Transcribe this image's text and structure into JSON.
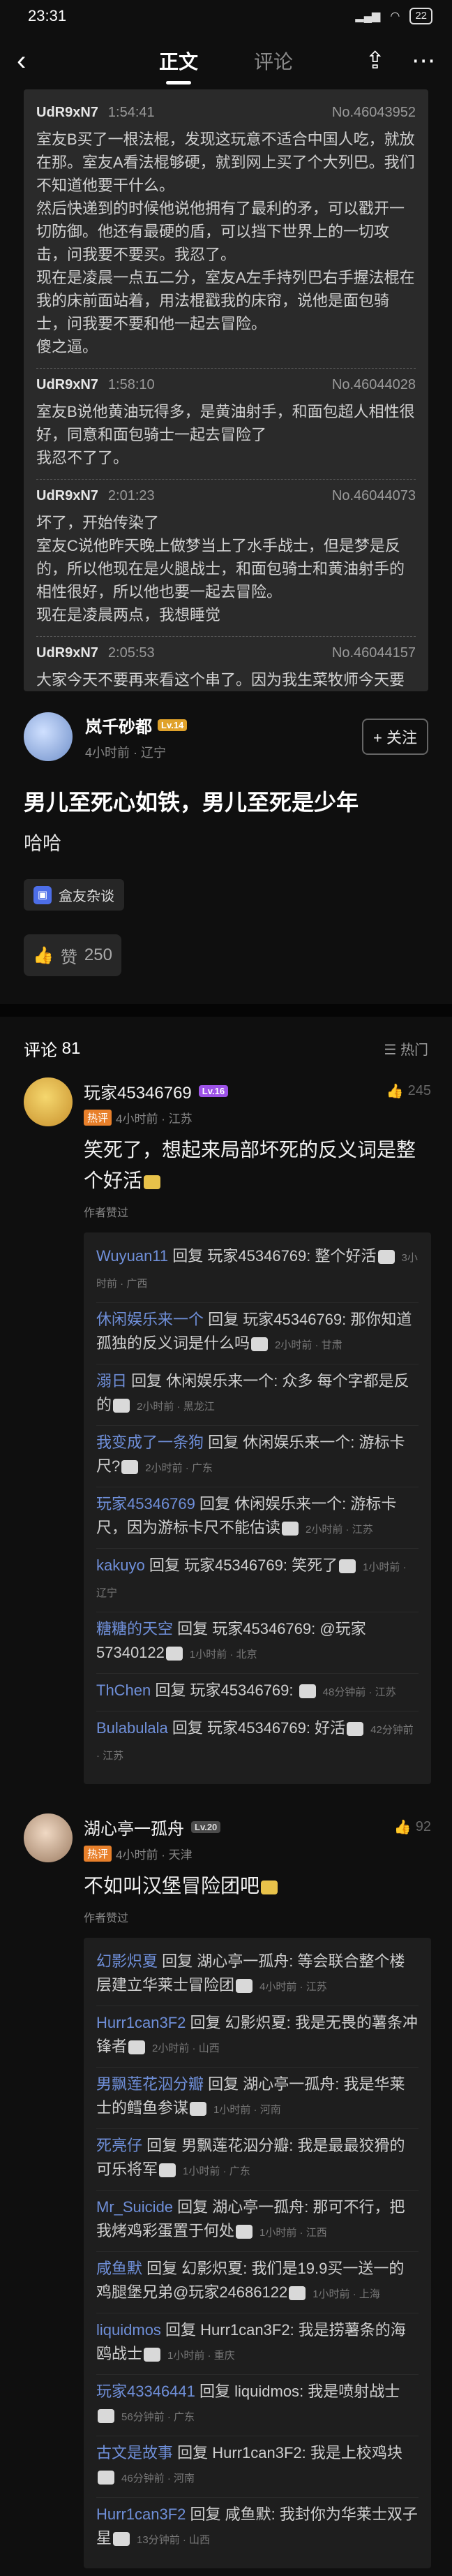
{
  "status": {
    "time": "23:31",
    "battery": "22"
  },
  "nav": {
    "tab_main": "正文",
    "tab_comments": "评论"
  },
  "quotes": [
    {
      "name": "UdR9xN7",
      "time": "1:54:41",
      "no": "No.46043952",
      "text": "室友B买了一根法棍，发现这玩意不适合中国人吃，就放在那。室友A看法棍够硬，就到网上买了个大列巴。我们不知道他要干什么。\n然后快递到的时候他说他拥有了最利的矛，可以戳开一切防御。他还有最硬的盾，可以挡下世界上的一切攻击，问我要不要买。我忍了。\n现在是凌晨一点五二分，室友A左手持列巴右手握法棍在我的床前面站着，用法棍戳我的床帘，说他是面包骑士，问我要不要和他一起去冒险。\n傻之逼。"
    },
    {
      "name": "UdR9xN7",
      "time": "1:58:10",
      "no": "No.46044028",
      "text": "室友B说他黄油玩得多，是黄油射手，和面包超人相性很好，同意和面包骑士一起去冒险了\n我忍不了了。"
    },
    {
      "name": "UdR9xN7",
      "time": "2:01:23",
      "no": "No.46044073",
      "text": "坏了，开始传染了\n室友C说他昨天晚上做梦当上了水手战士，但是梦是反的，所以他现在是火腿战士，和面包骑士和黄油射手的相性很好，所以他也要一起去冒险。\n现在是凌晨两点，我想睡觉"
    },
    {
      "name": "UdR9xN7",
      "time": "2:05:53",
      "no": "No.46044157",
      "text": "大家今天不要再来看这个串了。因为我生菜牧师今天要和伙伴们一起出发去冒险了，没空更新。"
    }
  ],
  "author": {
    "name": "岚千砂都",
    "level": "Lv.14",
    "time": "4小时前",
    "location": "辽宁",
    "follow": "+ 关注"
  },
  "post": {
    "title": "男儿至死心如铁，男儿至死是少年",
    "body": "哈哈",
    "tag": "盒友杂谈",
    "likes": "250"
  },
  "comments_header": {
    "label": "评论",
    "count": "81",
    "sort": "热门"
  },
  "comments": [
    {
      "name": "玩家45346769",
      "level": "Lv.16",
      "likes": "245",
      "badge": "热评",
      "time": "4小时前",
      "location": "江苏",
      "text": "笑死了，想起来局部坏死的反义词是整个好活",
      "author_liked": "作者赞过",
      "replies": [
        {
          "user": "Wuyuan11",
          "to": "玩家45346769",
          "text": "整个好活",
          "meta": "3小时前 · 广西"
        },
        {
          "user": "休闲娱乐来一个",
          "to": "玩家45346769",
          "text": "那你知道孤独的反义词是什么吗",
          "meta": "2小时前 · 甘肃"
        },
        {
          "user": "溺日",
          "to": "休闲娱乐来一个",
          "text": "众多 每个字都是反的",
          "meta": "2小时前 · 黑龙江"
        },
        {
          "user": "我变成了一条狗",
          "to": "休闲娱乐来一个",
          "text": "游标卡尺?",
          "meta": "2小时前 · 广东"
        },
        {
          "user": "玩家45346769",
          "to": "休闲娱乐来一个",
          "text": "游标卡尺，因为游标卡尺不能估读",
          "meta": "2小时前 · 江苏"
        },
        {
          "user": "kakuyo",
          "to": "玩家45346769",
          "text": "笑死了",
          "meta": "1小时前 · 辽宁"
        },
        {
          "user": "糖糖的天空",
          "to": "玩家45346769",
          "text": "@玩家57340122",
          "meta": "1小时前 · 北京"
        },
        {
          "user": "ThChen",
          "to": "玩家45346769",
          "text": "",
          "meta": "48分钟前 · 江苏"
        },
        {
          "user": "Bulabulala",
          "to": "玩家45346769",
          "text": "好活",
          "meta": "42分钟前 · 江苏"
        }
      ]
    },
    {
      "name": "湖心亭一孤舟",
      "level": "Lv.20",
      "likes": "92",
      "badge": "热评",
      "time": "4小时前",
      "location": "天津",
      "text": "不如叫汉堡冒险团吧",
      "author_liked": "作者赞过",
      "replies": [
        {
          "user": "幻影炽夏",
          "to": "湖心亭一孤舟",
          "text": "等会联合整个楼层建立华莱士冒险团",
          "meta": "4小时前 · 江苏"
        },
        {
          "user": "Hurr1can3F2",
          "to": "幻影炽夏",
          "text": "我是无畏的薯条冲锋者",
          "meta": "2小时前 · 山西"
        },
        {
          "user": "男飘莲花泅分瓣",
          "to": "湖心亭一孤舟",
          "text": "我是华莱士的鳕鱼参谋",
          "meta": "1小时前 · 河南"
        },
        {
          "user": "死亮仔",
          "to": "男飘莲花泅分瓣",
          "text": "我是最最狡猾的可乐将军",
          "meta": "1小时前 · 广东"
        },
        {
          "user": "Mr_Suicide",
          "to": "湖心亭一孤舟",
          "text": "那可不行，把我烤鸡彩蛋置于何处",
          "meta": "1小时前 · 江西"
        },
        {
          "user": "咸鱼默",
          "to": "幻影炽夏",
          "text": "我们是19.9买一送一的鸡腿堡兄弟@玩家24686122",
          "meta": "1小时前 · 上海"
        },
        {
          "user": "liquidmos",
          "to": "Hurr1can3F2",
          "text": "我是捞薯条的海鸥战士",
          "meta": "1小时前 · 重庆"
        },
        {
          "user": "玩家43346441",
          "to": "liquidmos",
          "text": "我是喷射战士",
          "meta": "56分钟前 · 广东"
        },
        {
          "user": "古文是故事",
          "to": "Hurr1can3F2",
          "text": "我是上校鸡块",
          "meta": "46分钟前 · 河南"
        },
        {
          "user": "Hurr1can3F2",
          "to": "咸鱼默",
          "text": "我封你为华莱士双子星",
          "meta": "13分钟前 · 山西"
        }
      ]
    }
  ],
  "reply_word": "回复"
}
